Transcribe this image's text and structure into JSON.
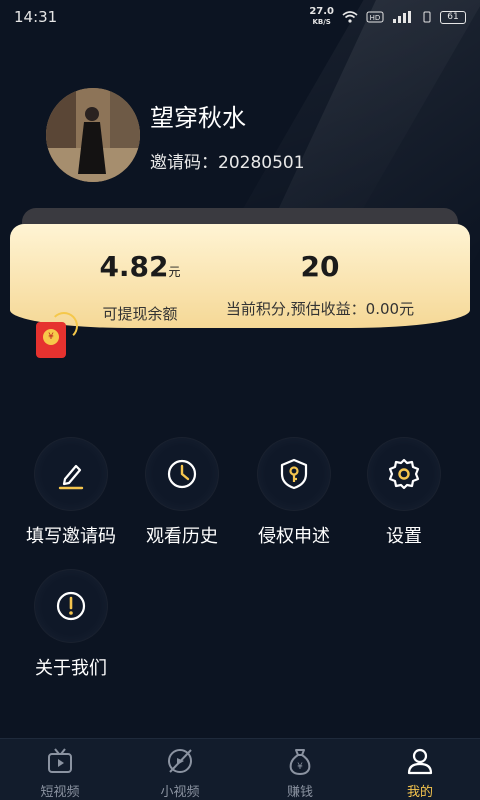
{
  "status_bar": {
    "time": "14:31",
    "net_speed": "27.0",
    "net_unit": "KB/S",
    "battery": "61"
  },
  "profile": {
    "username": "望穿秋水",
    "invite_code": "邀请码：20280501"
  },
  "wallet": {
    "balance_value": "4.82",
    "balance_unit": "元",
    "balance_label": "可提现余额",
    "points_value": "20",
    "points_label": "当前积分,预估收益：0.00元"
  },
  "menu": [
    {
      "label": "填写邀请码",
      "icon": "edit-icon"
    },
    {
      "label": "观看历史",
      "icon": "clock-icon"
    },
    {
      "label": "侵权申述",
      "icon": "shield-key-icon"
    },
    {
      "label": "设置",
      "icon": "gear-icon"
    },
    {
      "label": "关于我们",
      "icon": "info-icon"
    }
  ],
  "bottom_nav": [
    {
      "label": "短视频",
      "icon": "tv-icon",
      "active": false
    },
    {
      "label": "小视频",
      "icon": "leaf-play-icon",
      "active": false
    },
    {
      "label": "赚钱",
      "icon": "money-bag-icon",
      "active": false
    },
    {
      "label": "我的",
      "icon": "person-icon",
      "active": true
    }
  ],
  "colors": {
    "background": "#0c1422",
    "card_gold": "#f5d896",
    "accent": "#f5c54e",
    "icon_gold": "#f5c54e"
  }
}
